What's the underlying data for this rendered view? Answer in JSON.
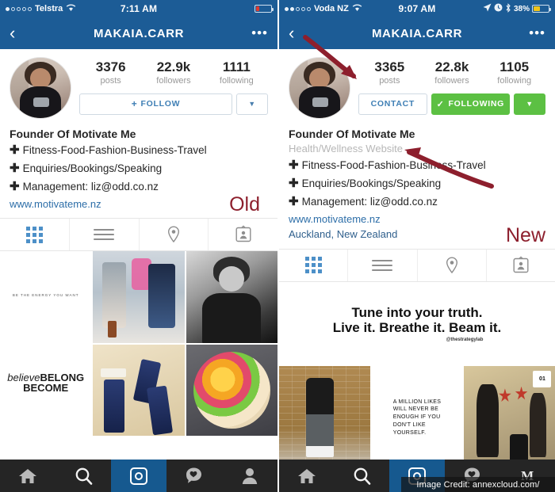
{
  "comparison": {
    "old_tag": "Old",
    "new_tag": "New"
  },
  "left": {
    "status": {
      "carrier": "Telstra",
      "signal_dots_filled": 1,
      "signal_dots_total": 5,
      "wifi_icon": "wifi-icon",
      "time": "7:11 AM",
      "battery_level": 18,
      "battery_color": "#e0392e"
    },
    "nav": {
      "back_icon": "chevron-left-icon",
      "title": "MAKAIA.CARR",
      "more_icon": "ellipsis-icon"
    },
    "stats": [
      {
        "num": "3376",
        "label": "posts"
      },
      {
        "num": "22.9k",
        "label": "followers"
      },
      {
        "num": "1111",
        "label": "following"
      }
    ],
    "actions": {
      "primary_label": "FOLLOW",
      "primary_icon": "plus-icon",
      "caret_icon": "chevron-down-icon"
    },
    "bio": {
      "name": "Founder Of Motivate Me",
      "lines": [
        "Fitness-Food-Fashion-Business-Travel",
        "Enquiries/Bookings/Speaking",
        "Management: liz@odd.co.nz"
      ],
      "bullet": "✚",
      "link": "www.motivateme.nz"
    },
    "tabs": [
      {
        "name": "grid-tab",
        "icon": "grid-icon",
        "active": true
      },
      {
        "name": "list-tab",
        "icon": "list-icon",
        "active": false
      },
      {
        "name": "location-tab",
        "icon": "map-pin-icon",
        "active": false
      },
      {
        "name": "tagged-tab",
        "icon": "tagged-photos-icon",
        "active": false
      }
    ],
    "grid": [
      {
        "name": "quote-post-energy",
        "kind": "quote",
        "small_text": "BE THE ENERGY YOU WANT",
        "big_text": ""
      },
      {
        "name": "street-style-post",
        "kind": "photo"
      },
      {
        "name": "black-white-portrait-post",
        "kind": "photo"
      },
      {
        "name": "quote-post-believe",
        "kind": "quote",
        "small_text": "",
        "big_text": "believe BELONG BECOME"
      },
      {
        "name": "drinks-flatlay-post",
        "kind": "photo"
      },
      {
        "name": "fruit-bowl-post",
        "kind": "photo"
      }
    ],
    "bottomnav": [
      {
        "name": "home-tab",
        "icon": "home-icon",
        "active": false
      },
      {
        "name": "search-tab",
        "icon": "search-icon",
        "active": false
      },
      {
        "name": "camera-tab",
        "icon": "instagram-camera-icon",
        "active": true
      },
      {
        "name": "activity-tab",
        "icon": "heart-speech-icon",
        "active": false
      },
      {
        "name": "profile-tab",
        "icon": "person-icon",
        "active": false
      }
    ]
  },
  "right": {
    "status": {
      "carrier": "Voda NZ",
      "signal_dots_filled": 2,
      "signal_dots_total": 5,
      "wifi_icon": "wifi-icon",
      "time": "9:07 AM",
      "location_icon": "location-arrow-icon",
      "alarm_icon": "alarm-icon",
      "bluetooth_icon": "bluetooth-icon",
      "battery_percent": "38%",
      "battery_level": 38,
      "battery_color": "#f0c419"
    },
    "nav": {
      "back_icon": "chevron-left-icon",
      "title": "MAKAIA.CARR",
      "more_icon": "ellipsis-icon"
    },
    "stats": [
      {
        "num": "3365",
        "label": "posts"
      },
      {
        "num": "22.8k",
        "label": "followers"
      },
      {
        "num": "1105",
        "label": "following"
      }
    ],
    "actions": {
      "contact_label": "CONTACT",
      "following_label": "FOLLOWING",
      "check_icon": "check-icon",
      "caret_icon": "chevron-down-icon",
      "following_color": "#5cc043"
    },
    "bio": {
      "name": "Founder Of Motivate Me",
      "category": "Health/Wellness Website",
      "lines": [
        "Fitness-Food-Fashion-Business-Travel",
        "Enquiries/Bookings/Speaking",
        "Management: liz@odd.co.nz"
      ],
      "bullet": "✚",
      "link": "www.motivateme.nz",
      "location": "Auckland, New Zealand"
    },
    "tabs": [
      {
        "name": "grid-tab",
        "icon": "grid-icon",
        "active": true
      },
      {
        "name": "list-tab",
        "icon": "list-icon",
        "active": false
      },
      {
        "name": "location-tab",
        "icon": "map-pin-icon",
        "active": false
      },
      {
        "name": "tagged-tab",
        "icon": "tagged-photos-icon",
        "active": false
      }
    ],
    "grid": [
      {
        "name": "quote-post-tune-in",
        "kind": "quote",
        "big_text": "Tune into your truth.",
        "big_text2": "Live it. Breathe it. Beam it.",
        "handle": "@thestrategylab"
      },
      {
        "name": "brick-wall-post",
        "kind": "photo"
      },
      {
        "name": "handwritten-quote-post",
        "kind": "quote",
        "hand_text": "A MILLION LIKES\nWILL NEVER BE\nENOUGH IF YOU\nDON'T LIKE\n   YOURSELF."
      },
      {
        "name": "office-video-post",
        "kind": "photo",
        "badge": "01"
      }
    ],
    "bottomnav": [
      {
        "name": "home-tab",
        "icon": "home-icon",
        "active": false
      },
      {
        "name": "search-tab",
        "icon": "search-icon",
        "active": false
      },
      {
        "name": "camera-tab",
        "icon": "instagram-camera-icon",
        "active": true
      },
      {
        "name": "activity-tab",
        "icon": "heart-speech-icon",
        "active": false
      },
      {
        "name": "profile-tab",
        "icon": "m-logo-icon",
        "label": "M",
        "active": false
      }
    ]
  },
  "watermark": {
    "text": "Image Credit: annexcloud.com/"
  },
  "colors": {
    "header_blue": "#1c5c96",
    "link_blue": "#2d6ea8",
    "green": "#5cc043",
    "annotation_red": "#8d1f2d"
  }
}
